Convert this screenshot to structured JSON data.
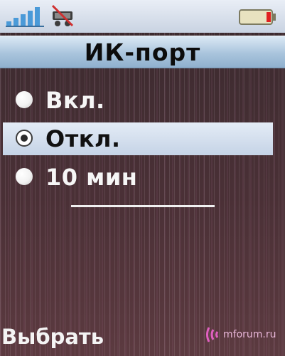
{
  "status_bar": {
    "signal_icon": "signal-strength-icon",
    "bluetooth_icon": "bluetooth-off-icon",
    "battery_icon": "battery-low-icon"
  },
  "title": "ИК-порт",
  "options": [
    {
      "label": "Вкл.",
      "selected": false
    },
    {
      "label": "Откл.",
      "selected": true
    },
    {
      "label": "10 мин",
      "selected": false
    }
  ],
  "softkey_left": "Выбрать",
  "watermark": "mforum.ru",
  "colors": {
    "title_bar": "#a9c4dc",
    "highlight": "#d4dfee",
    "battery_low": "#e02020",
    "background": "#4a3036"
  }
}
